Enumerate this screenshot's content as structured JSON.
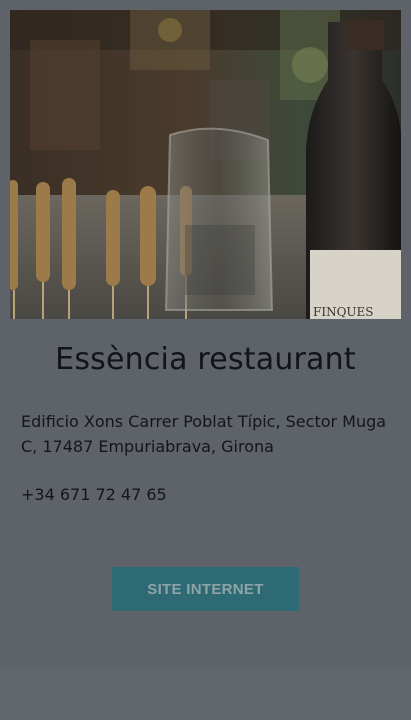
{
  "restaurant": {
    "name": "Essència restaurant",
    "address": "Edificio Xons Carrer Poblat Típic, Sector Muga C, 17487 Empuriabrava, Girona",
    "phone": "+34 671 72 47 65",
    "website_button": "SITE INTERNET",
    "photo_label_text": "FINQUES"
  },
  "colors": {
    "overlay": "#5e6269",
    "button": "#2d6a74",
    "button_text": "#8fa4a8",
    "text": "#141619"
  }
}
